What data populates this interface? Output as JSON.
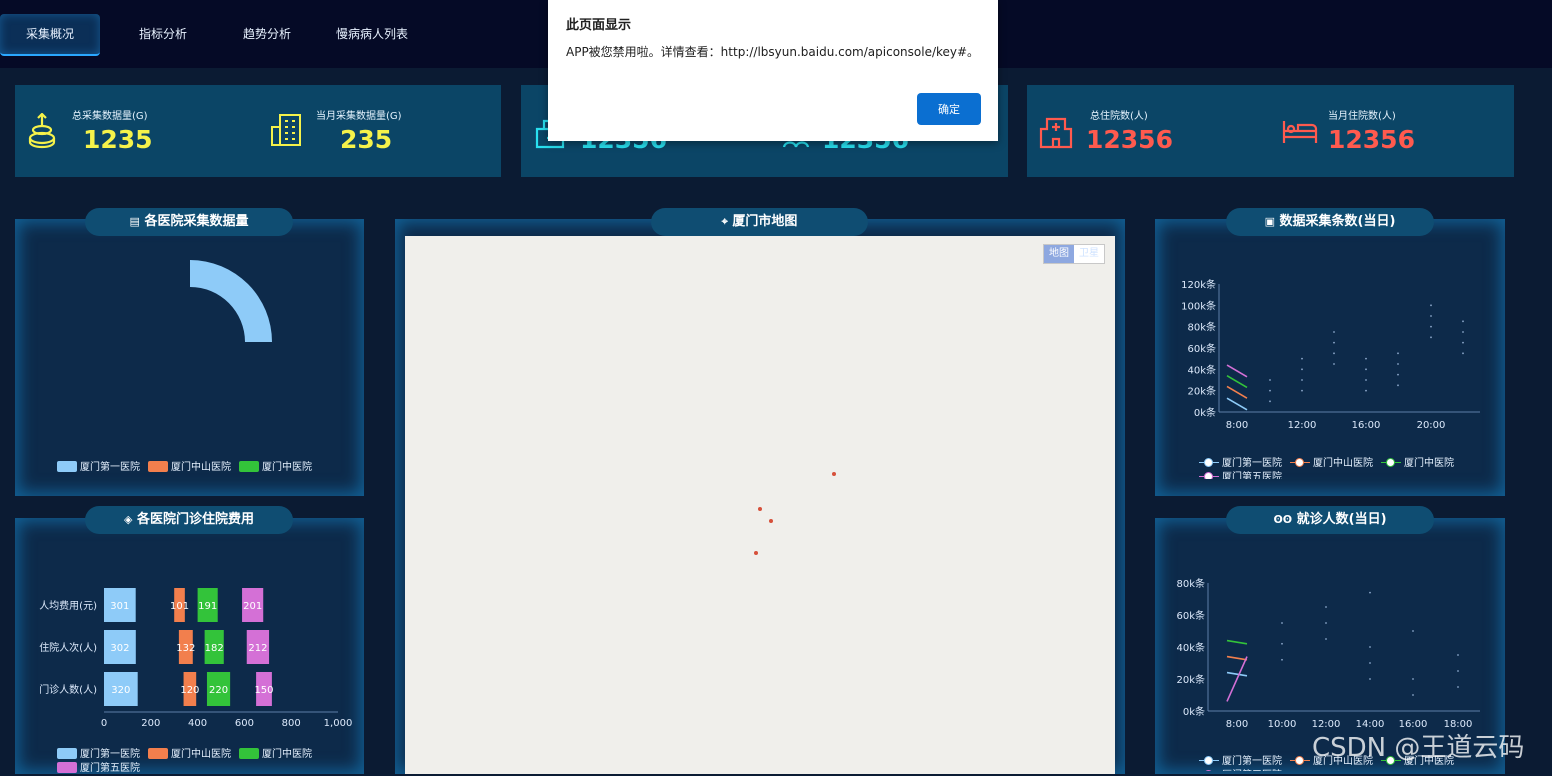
{
  "nav": {
    "tabs": [
      "采集概况",
      "指标分析",
      "趋势分析",
      "慢病病人列表"
    ],
    "active": 0
  },
  "stats": {
    "total_collect_label": "总采集数据量(G)",
    "total_collect_value": "1235",
    "month_collect_label": "当月采集数据量(G)",
    "month_collect_value": "235",
    "mid_left_value": "12356",
    "mid_right_value": "12356",
    "total_inpatient_label": "总住院数(人)",
    "total_inpatient_value": "12356",
    "month_inpatient_label": "当月住院数(人)",
    "month_inpatient_value": "12356",
    "colors": {
      "yellow": "#f5f24a",
      "cyan": "#29e0f0",
      "red": "#ff5a4e"
    }
  },
  "panels": {
    "collect_volume_title": "各医院采集数据量",
    "cost_title": "各医院门诊住院费用",
    "map_title": "厦门市地图",
    "records_title": "数据采集条数(当日)",
    "visits_title": "就诊人数(当日)"
  },
  "legend_hospitals": [
    "厦门第一医院",
    "厦门中山医院",
    "厦门中医院",
    "厦门第五医院"
  ],
  "colors": {
    "hospital1": "#8ecbf8",
    "hospital2": "#f27f4d",
    "hospital3": "#33c33a",
    "hospital4": "#d470d6",
    "accent": "#2aa8ff"
  },
  "map": {
    "type_map": "地图",
    "type_satellite": "卫星"
  },
  "dialog": {
    "title": "此页面显示",
    "message": "APP被您禁用啦。详情查看：http://lbsyun.baidu.com/apiconsole/key#。",
    "ok_label": "确定"
  },
  "watermark": "CSDN @王道云码",
  "chart_data": [
    {
      "type": "pie",
      "title": "各医院采集数据量",
      "series": [
        {
          "name": "厦门第一医院",
          "value": 25
        }
      ],
      "note_visible_portion": "single quarter-ring segment visible"
    },
    {
      "type": "bar",
      "orientation": "horizontal",
      "title": "各医院门诊住院费用",
      "categories": [
        "人均费用(元)",
        "住院人次(人)",
        "门诊人数(人)"
      ],
      "series": [
        {
          "name": "厦门第一医院",
          "values": [
            301,
            302,
            320
          ]
        },
        {
          "name": "厦门中山医院",
          "values": [
            101,
            132,
            120
          ]
        },
        {
          "name": "厦门中医院",
          "values": [
            191,
            182,
            220
          ]
        },
        {
          "name": "厦门第五医院",
          "values": [
            201,
            212,
            150
          ]
        }
      ],
      "xlim": [
        0,
        1000
      ],
      "xticks": [
        "0",
        "200",
        "400",
        "600",
        "800",
        "1,000"
      ]
    },
    {
      "type": "line",
      "title": "数据采集条数(当日)",
      "x": [
        "8:00",
        "9:00"
      ],
      "xticks": [
        "8:00",
        "12:00",
        "16:00",
        "20:00"
      ],
      "yticks": [
        "0k条",
        "20k条",
        "40k条",
        "60k条",
        "80k条",
        "100k条",
        "120k条"
      ],
      "ylim": [
        0,
        120
      ],
      "series": [
        {
          "name": "厦门第一医院",
          "values": [
            13,
            2
          ]
        },
        {
          "name": "厦门中山医院",
          "values": [
            24,
            13
          ]
        },
        {
          "name": "厦门中医院",
          "values": [
            34,
            23
          ]
        },
        {
          "name": "厦门第五医院",
          "values": [
            44,
            33
          ]
        }
      ]
    },
    {
      "type": "line",
      "title": "就诊人数(当日)",
      "x": [
        "8:00",
        "9:00"
      ],
      "xticks": [
        "8:00",
        "10:00",
        "12:00",
        "14:00",
        "16:00",
        "18:00"
      ],
      "yticks": [
        "0k条",
        "20k条",
        "40k条",
        "60k条",
        "80k条"
      ],
      "ylim": [
        0,
        80
      ],
      "series": [
        {
          "name": "厦门第一医院",
          "values": [
            24,
            22
          ]
        },
        {
          "name": "厦门中山医院",
          "values": [
            34,
            32
          ]
        },
        {
          "name": "厦门中医院",
          "values": [
            44,
            42
          ]
        },
        {
          "name": "厦门第五医院",
          "values": [
            6,
            34
          ]
        }
      ]
    }
  ]
}
